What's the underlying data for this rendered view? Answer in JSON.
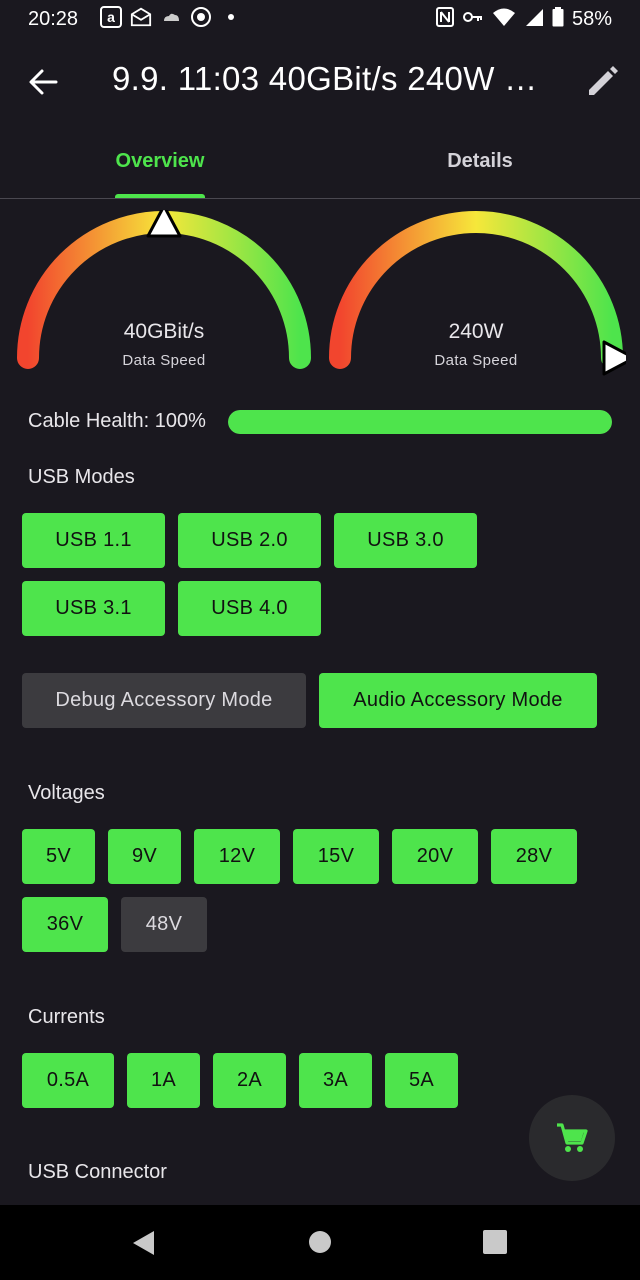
{
  "status_bar": {
    "time": "20:28",
    "battery": "58%",
    "left_icons": [
      "amazon-icon",
      "mail-icon",
      "cloud-icon",
      "browser-icon",
      "dot-icon"
    ],
    "right_icons": [
      "nfc-icon",
      "key-icon",
      "wifi-icon",
      "signal-icon",
      "battery-icon"
    ]
  },
  "app_bar": {
    "title": "9.9. 11:03 40GBit/s 240W …"
  },
  "tabs": [
    {
      "label": "Overview",
      "selected": true
    },
    {
      "label": "Details",
      "selected": false
    }
  ],
  "gauges": [
    {
      "value": "40GBit/s",
      "label": "Data Speed",
      "level": 0.5
    },
    {
      "value": "240W",
      "label": "Data Speed",
      "level": 1.0
    }
  ],
  "cable_health": {
    "label": "Cable Health: 100%",
    "level": 1.0
  },
  "usb_modes": {
    "title": "USB Modes",
    "items": [
      {
        "label": "USB 1.1",
        "active": true
      },
      {
        "label": "USB 2.0",
        "active": true
      },
      {
        "label": "USB 3.0",
        "active": true
      },
      {
        "label": "USB 3.1",
        "active": true
      },
      {
        "label": "USB 4.0",
        "active": true
      }
    ]
  },
  "accessory_modes": [
    {
      "label": "Debug Accessory Mode",
      "active": false
    },
    {
      "label": "Audio Accessory Mode",
      "active": true
    }
  ],
  "voltages": {
    "title": "Voltages",
    "items": [
      {
        "label": "5V",
        "active": true
      },
      {
        "label": "9V",
        "active": true
      },
      {
        "label": "12V",
        "active": true
      },
      {
        "label": "15V",
        "active": true
      },
      {
        "label": "20V",
        "active": true
      },
      {
        "label": "28V",
        "active": true
      },
      {
        "label": "36V",
        "active": true
      },
      {
        "label": "48V",
        "active": false
      }
    ]
  },
  "currents": {
    "title": "Currents",
    "items": [
      {
        "label": "0.5A",
        "active": true
      },
      {
        "label": "1A",
        "active": true
      },
      {
        "label": "2A",
        "active": true
      },
      {
        "label": "3A",
        "active": true
      },
      {
        "label": "5A",
        "active": true
      }
    ]
  },
  "usb_connector": {
    "title": "USB Connector"
  },
  "colors": {
    "accent": "#4ee44c",
    "chip_off": "#3c3b3f",
    "background": "#1a181f"
  }
}
